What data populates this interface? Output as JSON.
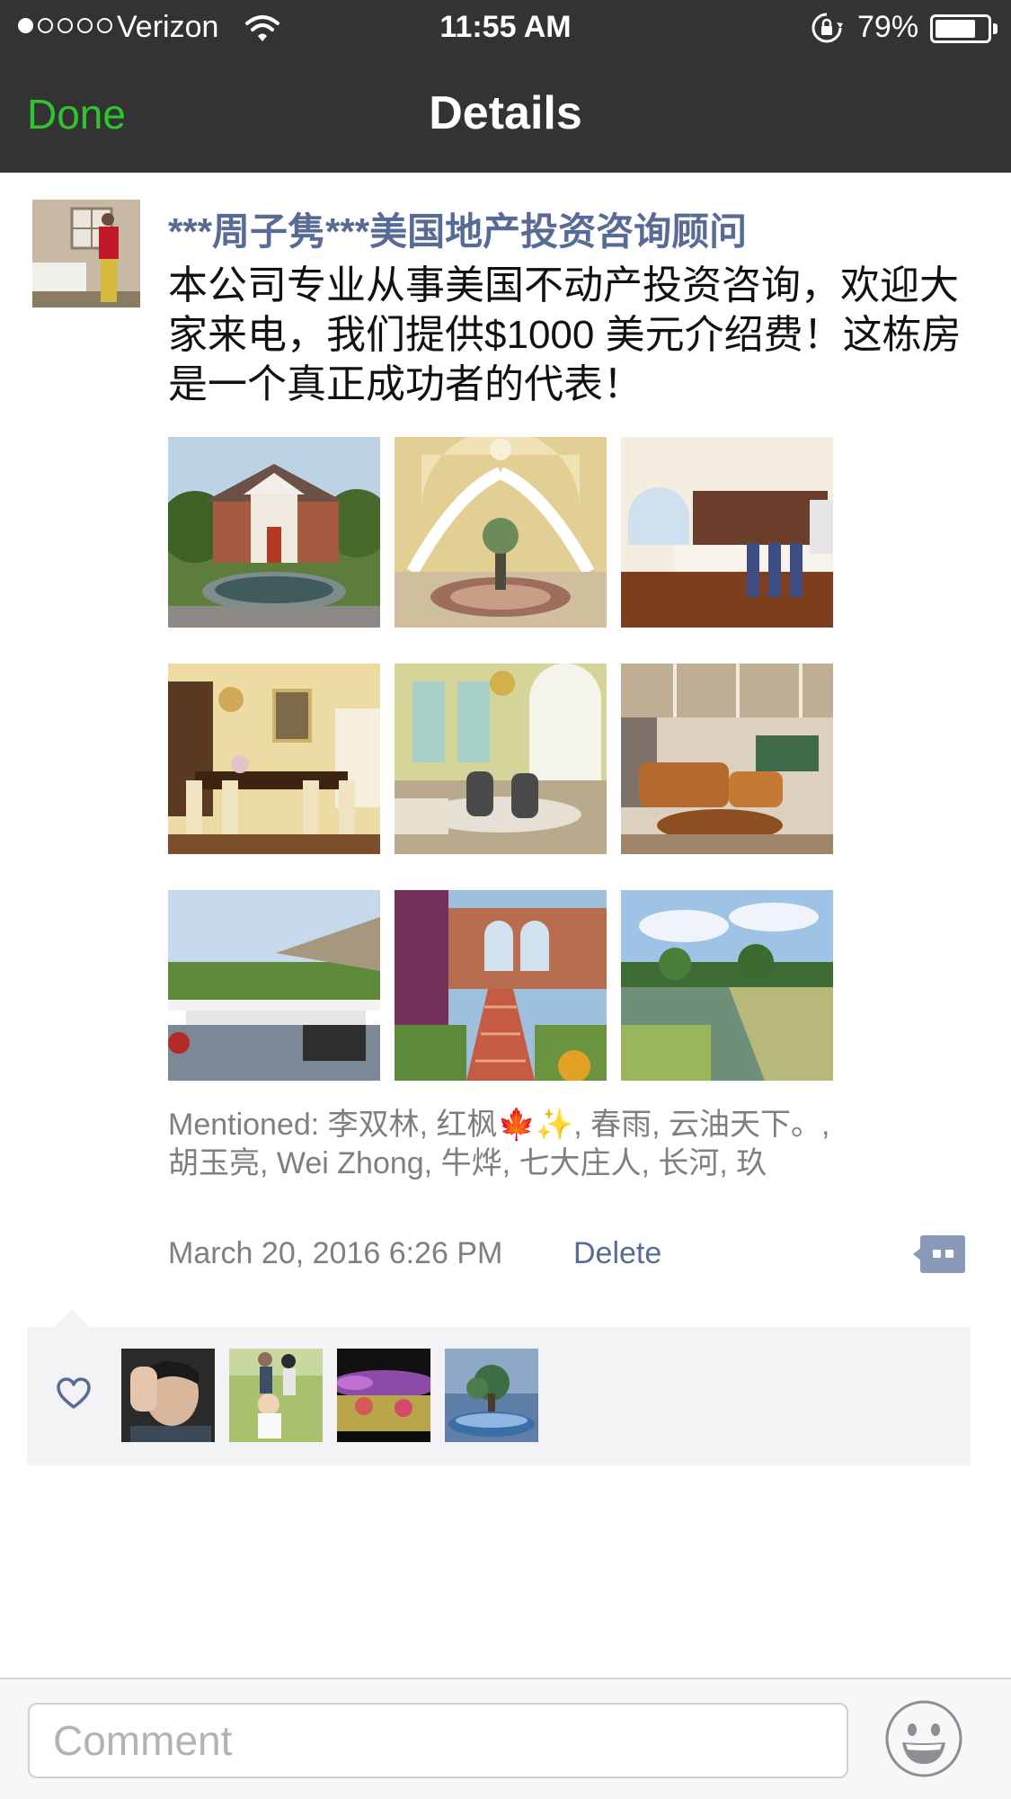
{
  "status_bar": {
    "carrier": "Verizon",
    "time": "11:55 AM",
    "battery_percent": "79%",
    "battery_level": 0.79,
    "signal_bars": 1,
    "signal_total": 5
  },
  "nav": {
    "done_label": "Done",
    "title": "Details"
  },
  "post": {
    "author": "***周子隽***美国地产投资咨询顾问",
    "content": "本公司专业从事美国不动产投资咨询，欢迎大家来电，我们提供$1000 美元介绍费！这栋房是一个真正成功者的代表！",
    "photos": [
      {
        "name": "photo-house-exterior"
      },
      {
        "name": "photo-grand-staircase"
      },
      {
        "name": "photo-kitchen"
      },
      {
        "name": "photo-dining-room"
      },
      {
        "name": "photo-living-room"
      },
      {
        "name": "photo-game-room"
      },
      {
        "name": "photo-patio"
      },
      {
        "name": "photo-rear-staircase"
      },
      {
        "name": "photo-pond"
      }
    ],
    "mentioned": "Mentioned: 李双林, 红枫🍁✨, 春雨, 云油天下。, 胡玉亮, Wei Zhong, 牛烨, 七大庄人, 长河, 玖",
    "timestamp": "March 20, 2016 6:26 PM",
    "delete_label": "Delete"
  },
  "likes": {
    "count_shown": 4
  },
  "comment_bar": {
    "placeholder": "Comment"
  },
  "colors": {
    "nav_bg": "#333333",
    "done_green": "#2ec52e",
    "link_blue": "#576b95",
    "meta_gray": "#7f7f7f",
    "likes_bg": "#f3f3f5"
  },
  "icons": {
    "status": [
      "wifi-icon",
      "orientation-lock-icon",
      "battery-icon"
    ],
    "actions": [
      "comment-bubble-icon",
      "heart-icon",
      "emoji-icon"
    ]
  }
}
